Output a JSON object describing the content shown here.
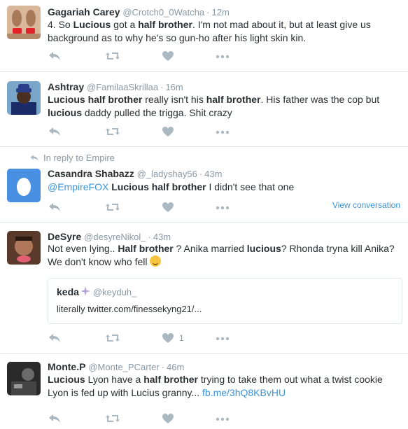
{
  "tweets": [
    {
      "name": "Gagariah Carey",
      "handle": "@Crotch0_0Watcha",
      "time": "12m",
      "text": [
        {
          "t": "4. So ",
          "b": false
        },
        {
          "t": "Lucious",
          "b": true
        },
        {
          "t": " got a ",
          "b": false
        },
        {
          "t": "half brother",
          "b": true
        },
        {
          "t": ". I'm not mad about it, but at least give us background as to why he's so gun-ho after his light skin kin.",
          "b": false
        }
      ]
    },
    {
      "name": "Ashtray",
      "handle": "@FamilaaSkrillaa",
      "time": "16m",
      "text": [
        {
          "t": "Lucious",
          "b": true
        },
        {
          "t": " ",
          "b": false
        },
        {
          "t": "half brother",
          "b": true
        },
        {
          "t": " really isn't his ",
          "b": false
        },
        {
          "t": "half brother",
          "b": true
        },
        {
          "t": ". His father was the cop but ",
          "b": false
        },
        {
          "t": "lucious",
          "b": true
        },
        {
          "t": " daddy pulled the trigga. Shit crazy",
          "b": false
        }
      ]
    },
    {
      "reply_context": "In reply to Empire",
      "name": "Casandra Shabazz",
      "handle": "@_ladyshay56",
      "time": "43m",
      "mention": "@EmpireFOX",
      "text": [
        {
          "t": " ",
          "b": false
        },
        {
          "t": "Lucious half brother",
          "b": true
        },
        {
          "t": " I didn't see that one",
          "b": false
        }
      ],
      "view_conversation": "View conversation"
    },
    {
      "name": "DeSyre",
      "handle": "@desyreNikol_",
      "time": "43m",
      "text": [
        {
          "t": "Not even lying.. ",
          "b": false
        },
        {
          "t": "Half brother",
          "b": true
        },
        {
          "t": " ? Anika married ",
          "b": false
        },
        {
          "t": "lucious",
          "b": true
        },
        {
          "t": "? Rhonda tryna kill Anika? We don't know who fell ",
          "b": false
        }
      ],
      "quote": {
        "name": "keda",
        "handle": "@keyduh_",
        "text": "literally  twitter.com/finessekyng21/..."
      },
      "like_count": "1"
    },
    {
      "name": "Monte.P",
      "handle": "@Monte_PCarter",
      "time": "46m",
      "text": [
        {
          "t": "Lucious",
          "b": true
        },
        {
          "t": " Lyon have a ",
          "b": false
        },
        {
          "t": "half brother",
          "b": true
        },
        {
          "t": " trying to take them out what a twist  cookie Lyon is fed up with Lucius granny... ",
          "b": false
        }
      ],
      "link": "fb.me/3hQ8KBvHU"
    }
  ],
  "colors": {
    "link": "#3b94d9",
    "muted": "#8899a6",
    "icon": "#aab8c2",
    "egg_bg": "#4a90e2"
  }
}
